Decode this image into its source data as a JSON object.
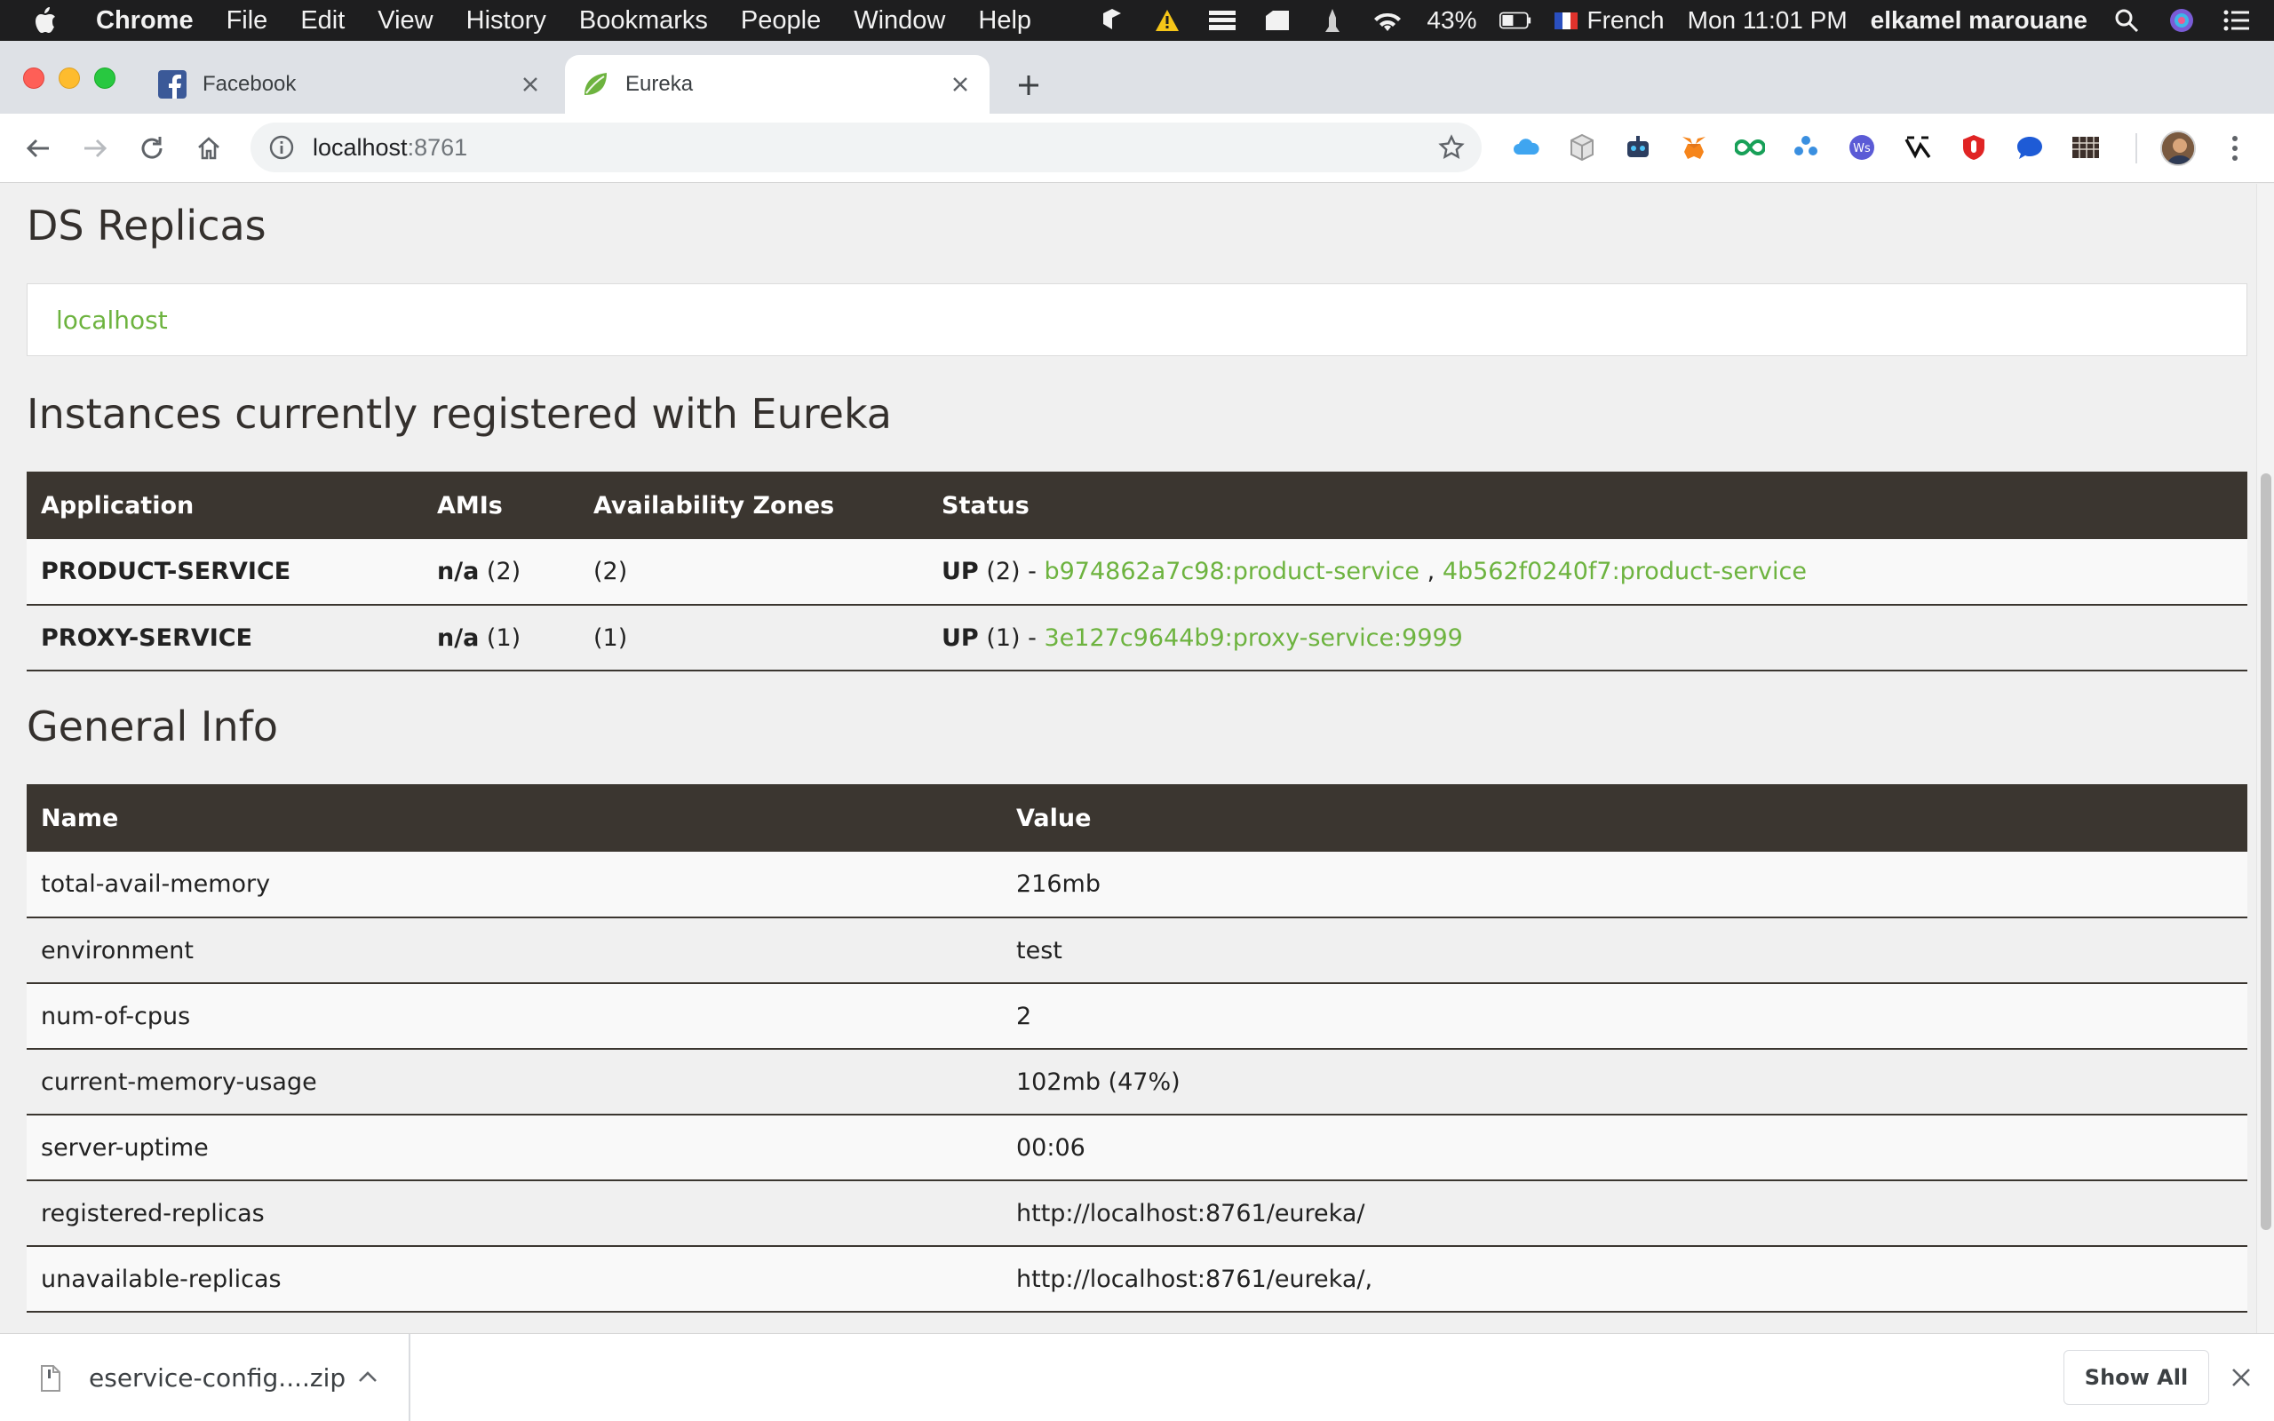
{
  "menubar": {
    "apple_icon": "apple-logo-icon",
    "app_name": "Chrome",
    "items": [
      "File",
      "Edit",
      "View",
      "History",
      "Bookmarks",
      "People",
      "Window",
      "Help"
    ],
    "battery_percent": "43%",
    "input_language": "French",
    "clock": "Mon 11:01 PM",
    "user": "elkamel marouane"
  },
  "tabs": [
    {
      "title": "Facebook",
      "icon": "facebook-icon",
      "active": false
    },
    {
      "title": "Eureka",
      "icon": "spring-leaf-icon",
      "active": true
    }
  ],
  "toolbar": {
    "url_host": "localhost",
    "url_port": ":8761"
  },
  "colors": {
    "accent_green": "#6db33f",
    "table_header": "#3b3630",
    "page_bg": "#f0f0f0"
  },
  "page": {
    "ds_replicas": {
      "title": "DS Replicas",
      "link": "localhost"
    },
    "instances": {
      "title": "Instances currently registered with Eureka",
      "columns": [
        "Application",
        "AMIs",
        "Availability Zones",
        "Status"
      ],
      "rows": [
        {
          "application": "PRODUCT-SERVICE",
          "ami_label": "n/a",
          "ami_count": "(2)",
          "zones": "(2)",
          "status_label": "UP",
          "status_count": "(2) -",
          "links": [
            "b974862a7c98:product-service",
            "4b562f0240f7:product-service"
          ],
          "link_separator": ","
        },
        {
          "application": "PROXY-SERVICE",
          "ami_label": "n/a",
          "ami_count": "(1)",
          "zones": "(1)",
          "status_label": "UP",
          "status_count": "(1) -",
          "links": [
            "3e127c9644b9:proxy-service:9999"
          ]
        }
      ]
    },
    "general_info": {
      "title": "General Info",
      "columns": [
        "Name",
        "Value"
      ],
      "rows": [
        {
          "name": "total-avail-memory",
          "value": "216mb"
        },
        {
          "name": "environment",
          "value": "test"
        },
        {
          "name": "num-of-cpus",
          "value": "2"
        },
        {
          "name": "current-memory-usage",
          "value": "102mb (47%)"
        },
        {
          "name": "server-uptime",
          "value": "00:06"
        },
        {
          "name": "registered-replicas",
          "value": "http://localhost:8761/eureka/"
        },
        {
          "name": "unavailable-replicas",
          "value": "http://localhost:8761/eureka/,"
        }
      ]
    }
  },
  "downloads": {
    "file_name": "eservice-config....zip",
    "show_all": "Show All"
  }
}
